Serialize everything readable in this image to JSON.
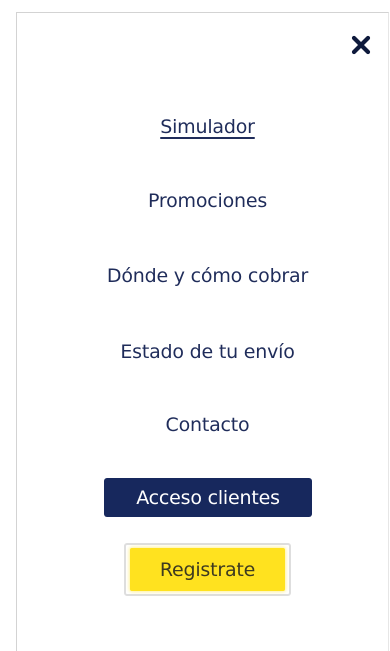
{
  "menu": {
    "close_icon": "close-icon",
    "items": [
      {
        "label": "Simulador",
        "active": true
      },
      {
        "label": "Promociones",
        "active": false
      },
      {
        "label": "Dónde y cómo cobrar",
        "active": false
      },
      {
        "label": "Estado de tu envío",
        "active": false
      },
      {
        "label": "Contacto",
        "active": false
      }
    ],
    "primary_button_label": "Acceso clientes",
    "secondary_button_label": "Registrate"
  },
  "colors": {
    "text": "#1f2c5a",
    "primary_button_bg": "#17285d",
    "secondary_button_bg": "#ffe21f"
  }
}
